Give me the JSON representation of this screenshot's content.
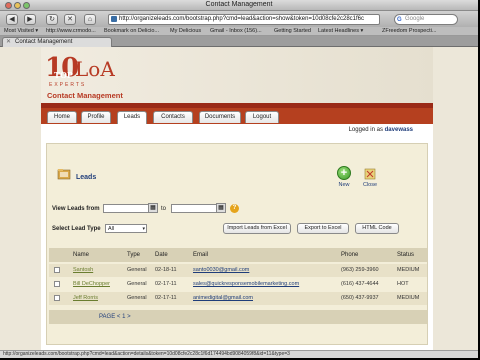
{
  "window": {
    "title": "Contact Management"
  },
  "toolbar": {
    "back": "◀",
    "forward": "▶",
    "reload": "↻",
    "stop": "✕",
    "home": "⌂",
    "url": "http://organizeleads.com/bootstrap.php?cmd=lead&action=show&token=10d08cfe2c28c1f6c",
    "search_placeholder": "Google"
  },
  "bookmarks": [
    "Most Visited ▾",
    "http://www.crmodo...",
    "Bookmark on Delicio...",
    "My Delicious",
    "Gmail - Inbox (156)...",
    "Getting Started",
    "Latest Headlines ▾",
    "ZFreedom Prospecti..."
  ],
  "tab": {
    "label": "Contact Management"
  },
  "logo": {
    "number": "10",
    "top": "TOP",
    "brand": "LoA",
    "sub": "EXPERTS",
    "product": "Contact Management"
  },
  "nav": [
    "Home",
    "Profile",
    "Leads",
    "Contacts",
    "Documents",
    "Logout"
  ],
  "nav_active": "Leads",
  "logged_in": {
    "prefix": "Logged in as",
    "user": "davewass"
  },
  "leads": {
    "title": "Leads",
    "new_label": "New",
    "close_label": "Close",
    "view_from_label": "View Leads from",
    "to_label": "to",
    "select_type_label": "Select Lead Type",
    "select_value": "All",
    "buttons": [
      "Import Leads from Excel",
      "Export to Excel",
      "HTML Code"
    ]
  },
  "table": {
    "columns": [
      "Name",
      "Type",
      "Date",
      "Email",
      "Phone",
      "Status"
    ],
    "rows": [
      {
        "name": "Santosh",
        "type": "General",
        "date": "02-18-11",
        "email": "santo0030@gmail.com",
        "phone": "(963) 259-3960",
        "status": "MEDIUM"
      },
      {
        "name": "Bill DeChopper",
        "type": "General",
        "date": "02-17-11",
        "email": "sales@quickresponsemobilemarketing.com",
        "phone": "(616) 437-4644",
        "status": "HOT"
      },
      {
        "name": "Jeff Rorris",
        "type": "General",
        "date": "02-17-11",
        "email": "animedigital@gmail.com",
        "phone": "(650) 437-9937",
        "status": "MEDIUM"
      }
    ],
    "pager": "PAGE < 1 >"
  },
  "statusbar": {
    "text": "http://organizeleads.com/bootstrap.php?cmd=lead&action=details&token=10d08cfe2c28c1f6d174494bd9084059f8&id=11&type=3"
  },
  "colors": {
    "brand_red": "#b73a24",
    "nav_band": "#b5401f",
    "link_blue": "#1f3d7a"
  }
}
